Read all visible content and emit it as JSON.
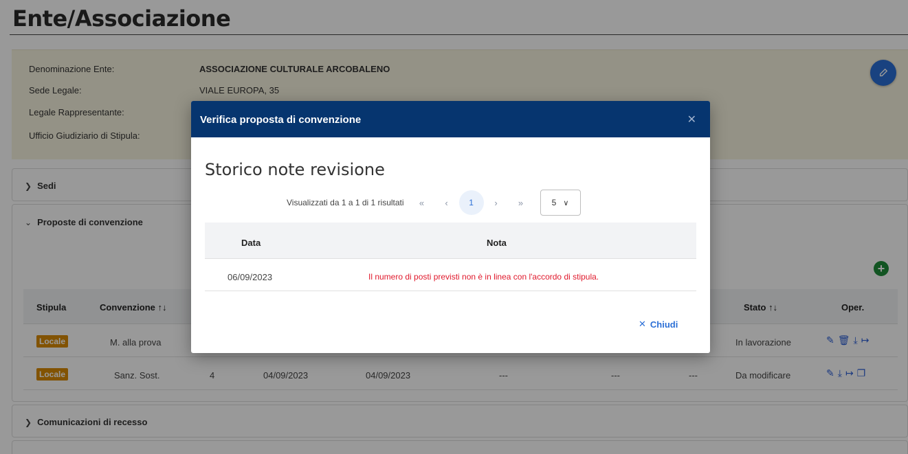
{
  "page": {
    "title": "Ente/Associazione"
  },
  "ente": {
    "rows": [
      {
        "label": "Denominazione Ente:",
        "value": "ASSOCIAZIONE CULTURALE ARCOBALENO"
      },
      {
        "label": "Sede Legale:",
        "value": "VIALE EUROPA, 35"
      },
      {
        "label": "Legale Rappresentante:",
        "value": ""
      },
      {
        "label": "Ufficio Giudiziario di Stipula:",
        "value": ""
      }
    ],
    "edit_icon": "pencil-icon"
  },
  "sections": {
    "sedi": "Sedi",
    "proposte": "Proposte di convenzione",
    "recesso": "Comunicazioni di recesso"
  },
  "table": {
    "headers": {
      "stipula": "Stipula",
      "convenzione": "Convenzione",
      "stato": "Stato",
      "oper": "Oper.",
      "sort_icon": "↑↓"
    },
    "rows": [
      {
        "stipula": "Locale",
        "convenzione": "M. alla prova",
        "col3": "",
        "col4": "",
        "col5": "",
        "col6": "",
        "col7": "",
        "col8": "",
        "stato": "In lavorazione",
        "ops": [
          "edit-icon",
          "delete-icon",
          "download-icon",
          "forward-icon"
        ]
      },
      {
        "stipula": "Locale",
        "convenzione": "Sanz. Sost.",
        "col3": "4",
        "col4": "04/09/2023",
        "col5": "04/09/2023",
        "col6": "---",
        "col7": "---",
        "col8": "---",
        "stato": "Da modificare",
        "ops": [
          "edit-icon",
          "download-icon",
          "forward-icon",
          "copy-icon"
        ]
      }
    ]
  },
  "modal": {
    "title": "Verifica proposta di convenzione",
    "heading": "Storico note revisione",
    "pager": {
      "summary": "Visualizzati da 1 a 1 di 1 risultati",
      "current_page": "1",
      "page_size": "5"
    },
    "columns": {
      "data": "Data",
      "nota": "Nota"
    },
    "rows": [
      {
        "data": "06/09/2023",
        "nota": "Il numero di posti previsti non è in linea con l'accordo di stipula."
      }
    ],
    "close_label": "Chiudi"
  },
  "colors": {
    "modal_header": "#06356f",
    "accent": "#2b6fd6",
    "badge": "#d98b06",
    "error": "#e0182b"
  }
}
